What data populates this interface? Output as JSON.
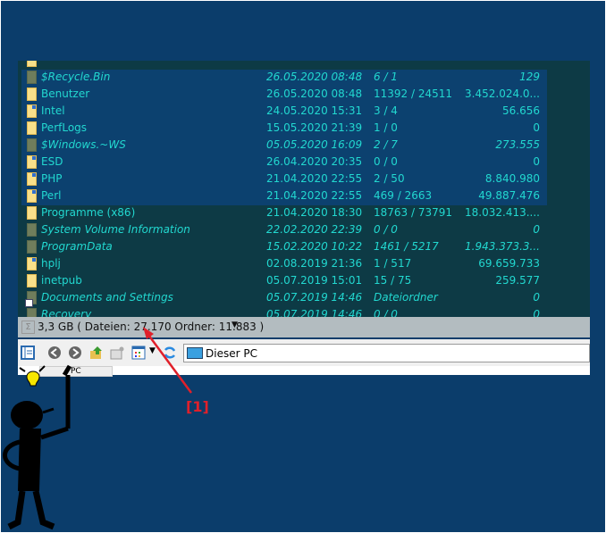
{
  "rows": [
    {
      "name": "$Recycle.Bin",
      "date": "26.05.2020 08:48",
      "count": "6 / 1",
      "size": "129",
      "system": true,
      "selected": true
    },
    {
      "name": "Benutzer",
      "date": "26.05.2020 08:48",
      "count": "11392 / 24511",
      "size": "3.452.024.0...",
      "selected": true
    },
    {
      "name": "Intel",
      "date": "24.05.2020 15:31",
      "count": "3 / 4",
      "size": "56.656",
      "marked": true,
      "selected": true
    },
    {
      "name": "PerfLogs",
      "date": "15.05.2020 21:39",
      "count": "1 / 0",
      "size": "0",
      "selected": true
    },
    {
      "name": "$Windows.~WS",
      "date": "05.05.2020 16:09",
      "count": "2 / 7",
      "size": "273.555",
      "system": true,
      "selected": true
    },
    {
      "name": "ESD",
      "date": "26.04.2020 20:35",
      "count": "0 / 0",
      "size": "0",
      "marked": true,
      "selected": true
    },
    {
      "name": "PHP",
      "date": "21.04.2020 22:55",
      "count": "2 / 50",
      "size": "8.840.980",
      "marked": true,
      "selected": true
    },
    {
      "name": "Perl",
      "date": "21.04.2020 22:55",
      "count": "469 / 2663",
      "size": "49.887.476",
      "marked": true,
      "selected": true
    },
    {
      "name": "Programme (x86)",
      "date": "21.04.2020 18:30",
      "count": "18763 / 73791",
      "size": "18.032.413...."
    },
    {
      "name": "System Volume Information",
      "date": "22.02.2020 22:39",
      "count": "0 / 0",
      "size": "0",
      "system": true
    },
    {
      "name": "ProgramData",
      "date": "15.02.2020 10:22",
      "count": "1461 / 5217",
      "size": "1.943.373.3...",
      "system": true
    },
    {
      "name": "hplj",
      "date": "02.08.2019 21:36",
      "count": "1 / 517",
      "size": "69.659.733",
      "marked": true
    },
    {
      "name": "inetpub",
      "date": "05.07.2019 15:01",
      "count": "15 / 75",
      "size": "259.577"
    },
    {
      "name": "Documents and Settings",
      "date": "05.07.2019 14:46",
      "count": "Dateiordner",
      "size": "0",
      "system": true,
      "link": true
    },
    {
      "name": "Recovery",
      "date": "05.07.2019 14:46",
      "count": "0 / 0",
      "size": "0",
      "system": true
    }
  ],
  "status": {
    "text": "3,3 GB ( Dateien: 27.170 Ordner: 11.883  )",
    "dropdown": "▼",
    "icon": "sigma-icon"
  },
  "toolbar": {
    "address": "Dieser PC"
  },
  "tab": {
    "label": "PC"
  },
  "annotation": {
    "label": "[1]",
    "color": "#e0202a"
  }
}
